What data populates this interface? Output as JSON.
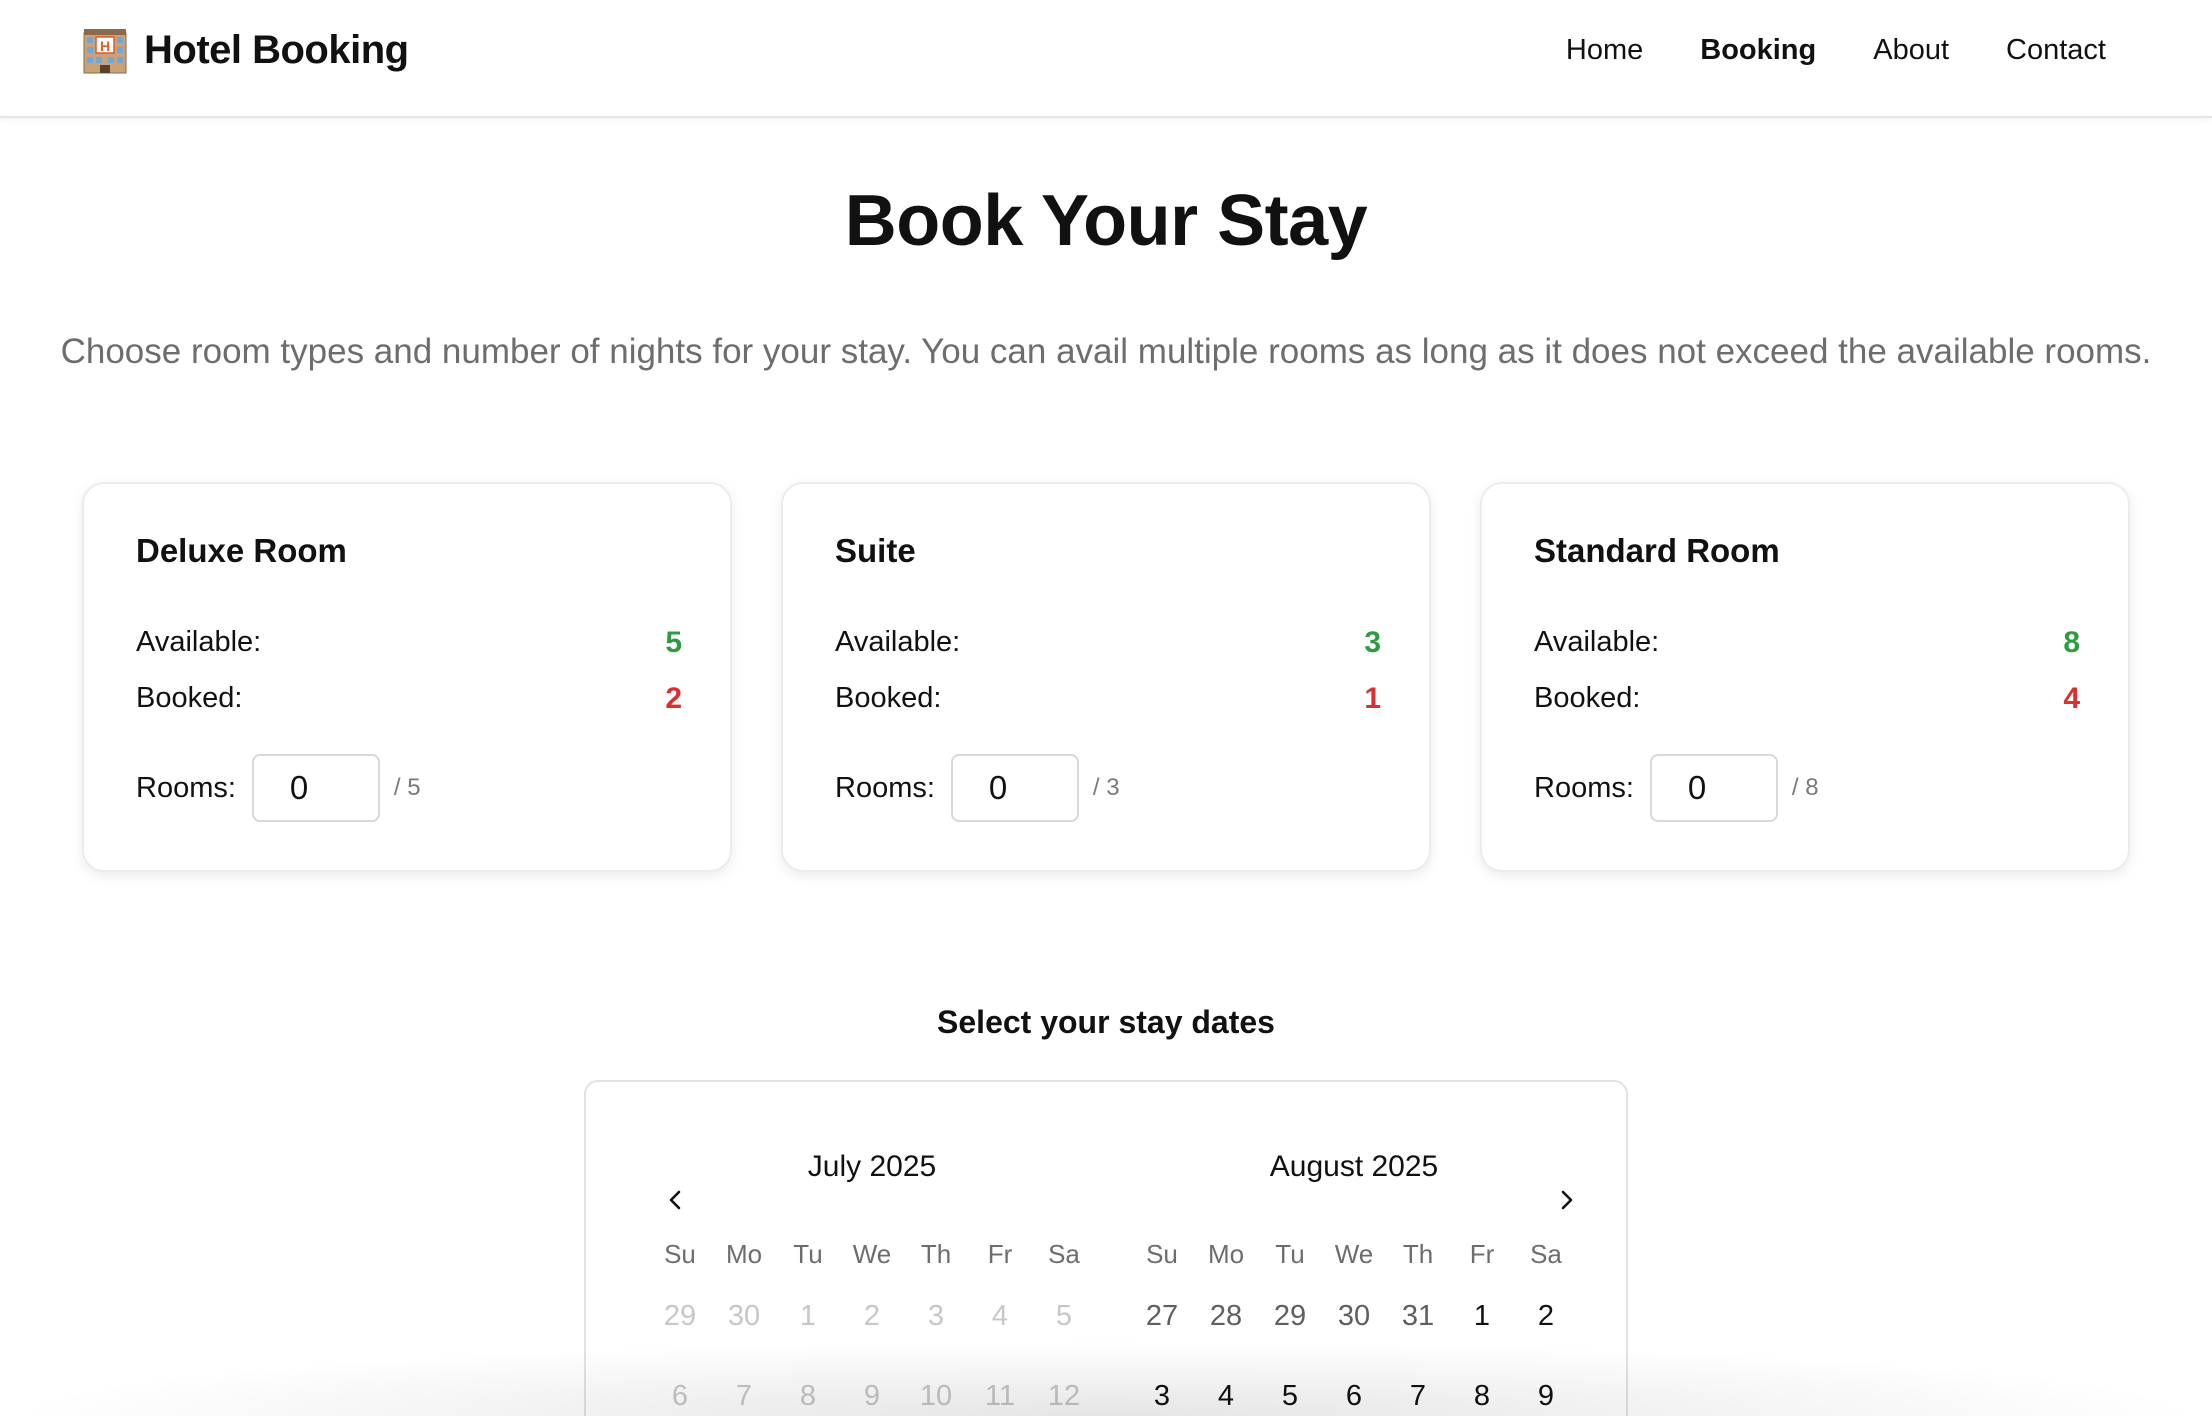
{
  "header": {
    "brand_icon": "hotel-icon",
    "brand_title": "Hotel Booking",
    "nav": [
      {
        "label": "Home",
        "active": false
      },
      {
        "label": "Booking",
        "active": true
      },
      {
        "label": "About",
        "active": false
      },
      {
        "label": "Contact",
        "active": false
      }
    ]
  },
  "hero": {
    "title": "Book Your Stay",
    "subtitle": "Choose room types and number of nights for your stay. You can avail multiple rooms as long as it does not exceed the available rooms."
  },
  "rooms": [
    {
      "name": "Deluxe Room",
      "available_label": "Available:",
      "available": "5",
      "booked_label": "Booked:",
      "booked": "2",
      "rooms_label": "Rooms:",
      "rooms_value": "0",
      "max": "/ 5"
    },
    {
      "name": "Suite",
      "available_label": "Available:",
      "available": "3",
      "booked_label": "Booked:",
      "booked": "1",
      "rooms_label": "Rooms:",
      "rooms_value": "0",
      "max": "/ 3"
    },
    {
      "name": "Standard Room",
      "available_label": "Available:",
      "available": "8",
      "booked_label": "Booked:",
      "booked": "4",
      "rooms_label": "Rooms:",
      "rooms_value": "0",
      "max": "/ 8"
    }
  ],
  "calendar": {
    "heading": "Select your stay dates",
    "prev_icon": "chevron-left-icon",
    "next_icon": "chevron-right-icon",
    "weekdays": [
      "Su",
      "Mo",
      "Tu",
      "We",
      "Th",
      "Fr",
      "Sa"
    ],
    "months": [
      {
        "title": "July 2025",
        "weeks": [
          [
            "29",
            "30",
            "1",
            "2",
            "3",
            "4",
            "5"
          ],
          [
            "6",
            "7",
            "8",
            "9",
            "10",
            "11",
            "12"
          ]
        ]
      },
      {
        "title": "August 2025",
        "weeks": [
          [
            "27",
            "28",
            "29",
            "30",
            "31",
            "1",
            "2"
          ],
          [
            "3",
            "4",
            "5",
            "6",
            "7",
            "8",
            "9"
          ]
        ]
      }
    ]
  },
  "colors": {
    "available": "#2e9b43",
    "booked": "#d93131",
    "text": "#111111",
    "muted": "#6d6d6d"
  }
}
